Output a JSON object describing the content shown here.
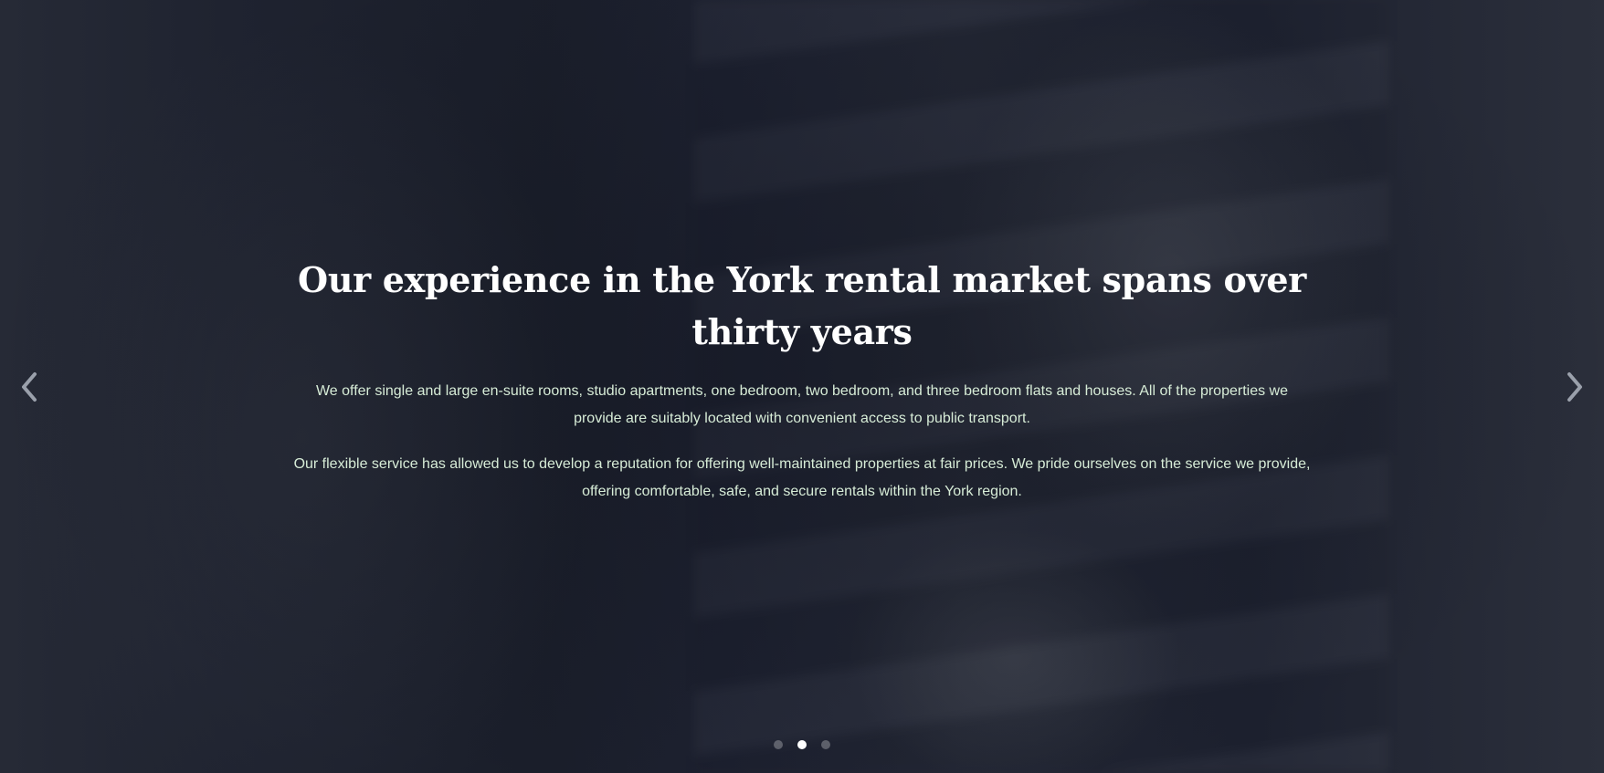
{
  "hero": {
    "headline": "Our experience in the York rental market spans over thirty years",
    "paragraphs": [
      "We offer single and large en-suite rooms, studio apartments, one bedroom, two bedroom, and three bedroom flats and houses. All of the properties we provide are suitably located with convenient access to public transport.",
      "Our flexible service has allowed us to develop a reputation for offering well-maintained properties at fair prices. We pride ourselves on the service we provide, offering comfortable, safe, and secure rentals within the York region."
    ]
  },
  "carousel": {
    "prev_icon": "chevron-left-icon",
    "next_icon": "chevron-right-icon",
    "slide_count": 3,
    "active_slide": 2,
    "arrow_color": "#9aa0ab"
  },
  "colors": {
    "overlay": "#1a1e2a",
    "headline": "#ffffff",
    "body_text": "#d7ecd7"
  }
}
